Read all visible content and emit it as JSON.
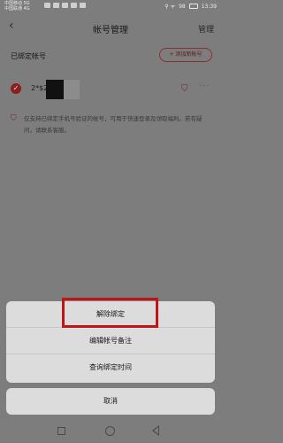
{
  "statusbar": {
    "carrier_line1": "中国移动 5G",
    "carrier_line2": "中国联通 4G",
    "signal_text": "⚲ ᯤ",
    "battery_pct": "98",
    "time": "13:39"
  },
  "navbar": {
    "title": "帐号管理",
    "manage_label": "管理"
  },
  "section": {
    "title": "已绑定帐号",
    "add_button": "+ 添加新帐号"
  },
  "account": {
    "name_prefix": "2*$2"
  },
  "notice": {
    "text": "仅支持已绑定手机号验证的帐号，可用于快速登录及领取福利。若有疑问，请联系客服。"
  },
  "sheet": {
    "items": [
      "解除绑定",
      "编辑帐号备注",
      "查询绑定时间"
    ],
    "cancel": "取消"
  },
  "colors": {
    "highlight": "#c01515",
    "accent": "#8a1f1f"
  },
  "icons": {
    "back": "back-arrow-icon",
    "shield": "shield-icon",
    "more": "more-icon",
    "check": "check-icon"
  }
}
